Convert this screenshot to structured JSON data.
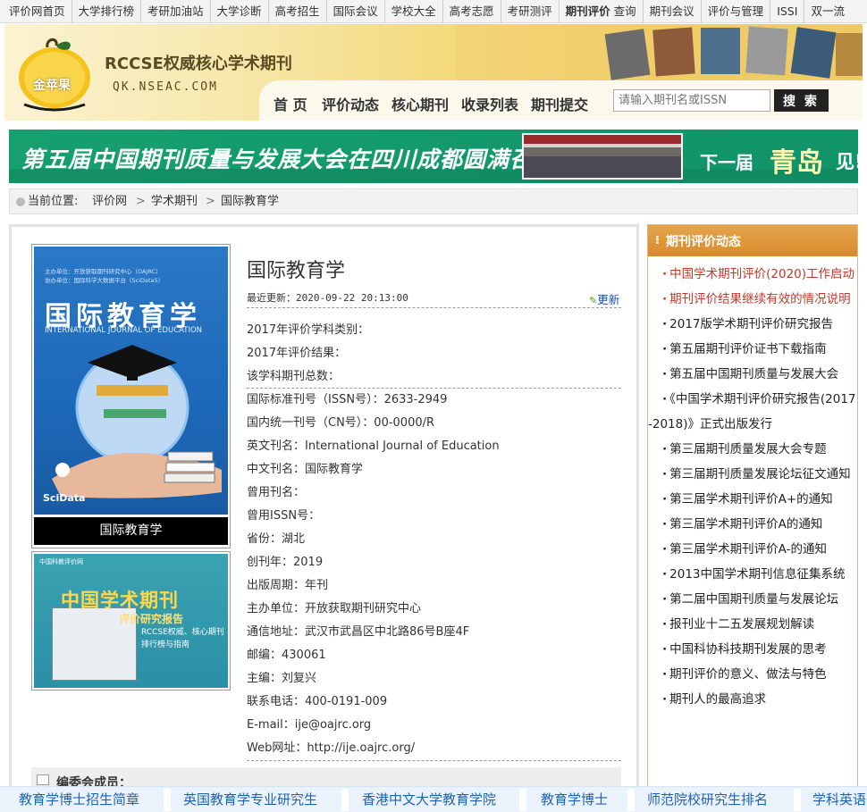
{
  "topnav": {
    "items": [
      "评价网首页",
      "大学排行榜",
      "考研加油站",
      "大学诊断",
      "高考招生",
      "国际会议",
      "学校大全",
      "高考志愿",
      "考研测评",
      "期刊评价",
      "查询",
      "期刊会议",
      "评价与管理",
      "ISSI",
      "双一流"
    ]
  },
  "header": {
    "logo_mark": "金苹果",
    "site_title": "RCCSE权威核心学术期刊",
    "site_url": "QK.NSEAC.COM",
    "menu": [
      "首 页",
      "评价动态",
      "核心期刊",
      "收录列表",
      "期刊提交"
    ],
    "search_placeholder": "请输入期刊名或ISSN",
    "search_button": "搜 索"
  },
  "banner": {
    "main_text": "第五届中国期刊质量与发展大会在四川成都圆满召开!",
    "next_prefix": "下一届",
    "next_city": "青岛",
    "next_suffix": "见!"
  },
  "breadcrumb": {
    "label": "当前位置:",
    "items": [
      "评价网",
      "学术期刊",
      "国际教育学"
    ],
    "separator": ">"
  },
  "cover": {
    "line1": "主办单位：开放获取期刊研究中心（OAJRC）",
    "line2": "协办单位：国际科学大数据平台（SciData5）",
    "title": "国际教育学",
    "subtitle": "INTERNATIONAL JOURNAL OF EDUCATION",
    "brand": "SciData",
    "caption": "国际教育学"
  },
  "ad": {
    "top_text": "中国科教评价网",
    "title": "中国学术期刊",
    "subtitle": "评价研究报告",
    "line1": "RCCSE权威、核心期刊",
    "line2": "排行榜与指南"
  },
  "journal": {
    "title": "国际教育学",
    "updated": "最近更新：2020-09-22 20:13:00",
    "update_link": "更新",
    "rows": [
      "2017年评价学科类别：",
      "2017年评价结果：",
      "该学科期刊总数：",
      "国际标准刊号（ISSN号）：2633-2949",
      "国内统一刊号（CN号）：00-0000/R",
      "英文刊名：International Journal of Education",
      "中文刊名：国际教育学",
      "曾用刊名：",
      "曾用ISSN号：",
      "省份：湖北",
      "创刊年：2019",
      "出版周期：年刊",
      "主办单位：开放获取期刊研究中心",
      "通信地址：武汉市武昌区中北路86号B座4F",
      "邮编：430061",
      "主编：刘复兴",
      "联系电话：400-0191-009",
      "E-mail：ije@oajrc.org",
      "Web网址：http://ije.oajrc.org/"
    ],
    "editors_label": "编委会成员："
  },
  "sidebar": {
    "title": "期刊评价动态",
    "items": [
      "中国学术期刊评价(2020)工作启动",
      "期刊评价结果继续有效的情况说明",
      "2017版学术期刊评价研究报告",
      "第五届期刊评价证书下载指南",
      "第五届中国期刊质量与发展大会",
      "《中国学术期刊评价研究报告(2017-2018)》正式出版发行",
      "第三届期刊质量发展大会专题",
      "第三届期刊质量发展论坛征文通知",
      "第三届学术期刊评价A+的通知",
      "第三届学术期刊评价A的通知",
      "第三届学术期刊评价A-的通知",
      "2013中国学术期刊信息征集系统",
      "第二届中国期刊质量与发展论坛",
      "报刊业十二五发展规划解读",
      "中国科协科技期刊发展的思考",
      "期刊评价的意义、做法与特色",
      "期刊人的最高追求"
    ]
  },
  "bottombar": {
    "links": [
      "教育学博士招生简章",
      "英国教育学专业研究生",
      "香港中文大学教育学院",
      "教育学博士",
      "师范院校研究生排名",
      "学科英语"
    ]
  },
  "colors": {
    "banner_green": "#17a06e",
    "sidebar_orange": "#d98a2a",
    "link_blue": "#1f62b0",
    "highlight_red": "#c0392b"
  }
}
